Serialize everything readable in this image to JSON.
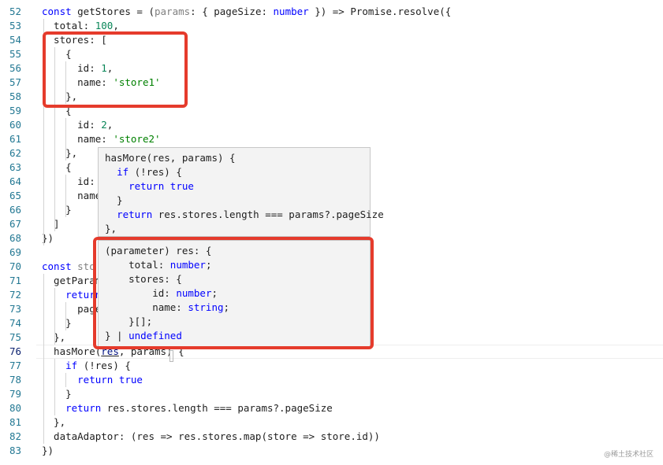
{
  "lines": [
    {
      "n": "52",
      "parts": [
        {
          "t": "const ",
          "c": "kw"
        },
        {
          "t": "getStores = (",
          "c": "plain"
        },
        {
          "t": "params",
          "c": "param"
        },
        {
          "t": ": { pageSize: ",
          "c": "plain"
        },
        {
          "t": "number",
          "c": "kw"
        },
        {
          "t": " }) => Promise.resolve({",
          "c": "plain"
        }
      ]
    },
    {
      "n": "53",
      "parts": [
        {
          "t": "  total: ",
          "c": "plain"
        },
        {
          "t": "100",
          "c": "num"
        },
        {
          "t": ",",
          "c": "plain"
        }
      ]
    },
    {
      "n": "54",
      "parts": [
        {
          "t": "  stores: [",
          "c": "plain"
        }
      ]
    },
    {
      "n": "55",
      "parts": [
        {
          "t": "    {",
          "c": "plain"
        }
      ]
    },
    {
      "n": "56",
      "parts": [
        {
          "t": "      id: ",
          "c": "plain"
        },
        {
          "t": "1",
          "c": "num"
        },
        {
          "t": ",",
          "c": "plain"
        }
      ]
    },
    {
      "n": "57",
      "parts": [
        {
          "t": "      name: ",
          "c": "plain"
        },
        {
          "t": "'store1'",
          "c": "str2"
        }
      ]
    },
    {
      "n": "58",
      "parts": [
        {
          "t": "    },",
          "c": "plain"
        }
      ]
    },
    {
      "n": "59",
      "parts": [
        {
          "t": "    {",
          "c": "plain"
        }
      ]
    },
    {
      "n": "60",
      "parts": [
        {
          "t": "      id: ",
          "c": "plain"
        },
        {
          "t": "2",
          "c": "num"
        },
        {
          "t": ",",
          "c": "plain"
        }
      ]
    },
    {
      "n": "61",
      "parts": [
        {
          "t": "      name: ",
          "c": "plain"
        },
        {
          "t": "'store2'",
          "c": "str2"
        }
      ]
    },
    {
      "n": "62",
      "parts": [
        {
          "t": "    },",
          "c": "plain"
        }
      ]
    },
    {
      "n": "63",
      "parts": [
        {
          "t": "    {",
          "c": "plain"
        }
      ]
    },
    {
      "n": "64",
      "parts": [
        {
          "t": "      id:",
          "c": "plain"
        }
      ]
    },
    {
      "n": "65",
      "parts": [
        {
          "t": "      name",
          "c": "plain"
        }
      ]
    },
    {
      "n": "66",
      "parts": [
        {
          "t": "    }",
          "c": "plain"
        }
      ]
    },
    {
      "n": "67",
      "parts": [
        {
          "t": "  ]",
          "c": "plain"
        }
      ]
    },
    {
      "n": "68",
      "parts": [
        {
          "t": "})",
          "c": "plain"
        }
      ]
    },
    {
      "n": "69",
      "parts": []
    },
    {
      "n": "70",
      "parts": [
        {
          "t": "const ",
          "c": "kw"
        },
        {
          "t": "sto",
          "c": "param"
        }
      ]
    },
    {
      "n": "71",
      "parts": [
        {
          "t": "  getParam",
          "c": "plain"
        }
      ]
    },
    {
      "n": "72",
      "parts": [
        {
          "t": "    ",
          "c": "plain"
        },
        {
          "t": "return",
          "c": "kw"
        }
      ]
    },
    {
      "n": "73",
      "parts": [
        {
          "t": "      page",
          "c": "plain"
        }
      ]
    },
    {
      "n": "74",
      "parts": [
        {
          "t": "    }",
          "c": "plain"
        }
      ]
    },
    {
      "n": "75",
      "parts": [
        {
          "t": "  },",
          "c": "plain"
        }
      ]
    },
    {
      "n": "76",
      "parts": [
        {
          "t": "  hasMore(",
          "c": "plain"
        },
        {
          "t": "res",
          "c": "prop"
        },
        {
          "t": ", params) {",
          "c": "plain"
        }
      ]
    },
    {
      "n": "77",
      "parts": [
        {
          "t": "    ",
          "c": "plain"
        },
        {
          "t": "if",
          "c": "kw"
        },
        {
          "t": " (!res) {",
          "c": "plain"
        }
      ]
    },
    {
      "n": "78",
      "parts": [
        {
          "t": "      ",
          "c": "plain"
        },
        {
          "t": "return true",
          "c": "kw"
        }
      ]
    },
    {
      "n": "79",
      "parts": [
        {
          "t": "    }",
          "c": "plain"
        }
      ]
    },
    {
      "n": "80",
      "parts": [
        {
          "t": "    ",
          "c": "plain"
        },
        {
          "t": "return",
          "c": "kw"
        },
        {
          "t": " res.stores.length === params?.pageSize",
          "c": "plain"
        }
      ]
    },
    {
      "n": "81",
      "parts": [
        {
          "t": "  },",
          "c": "plain"
        }
      ]
    },
    {
      "n": "82",
      "parts": [
        {
          "t": "  dataAdaptor: (res => res.stores.map(store => store.id))",
          "c": "plain"
        }
      ]
    },
    {
      "n": "83",
      "parts": [
        {
          "t": "})",
          "c": "plain"
        }
      ]
    }
  ],
  "active_line": "76",
  "hover_preview": [
    [
      {
        "t": "hasMore(res, params) {",
        "c": "plain"
      }
    ],
    [
      {
        "t": "  ",
        "c": "plain"
      },
      {
        "t": "if",
        "c": "kw"
      },
      {
        "t": " (!res) {",
        "c": "plain"
      }
    ],
    [
      {
        "t": "    ",
        "c": "plain"
      },
      {
        "t": "return true",
        "c": "kw"
      }
    ],
    [
      {
        "t": "  }",
        "c": "plain"
      }
    ],
    [
      {
        "t": "  ",
        "c": "plain"
      },
      {
        "t": "return",
        "c": "kw"
      },
      {
        "t": " res.stores.length === params?.pageSize",
        "c": "plain"
      }
    ],
    [
      {
        "t": "},",
        "c": "plain"
      }
    ]
  ],
  "hover_type": [
    [
      {
        "t": "(parameter) res: {",
        "c": "plain"
      }
    ],
    [
      {
        "t": "    total: ",
        "c": "plain"
      },
      {
        "t": "number",
        "c": "kw"
      },
      {
        "t": ";",
        "c": "plain"
      }
    ],
    [
      {
        "t": "    stores: {",
        "c": "plain"
      }
    ],
    [
      {
        "t": "        id: ",
        "c": "plain"
      },
      {
        "t": "number",
        "c": "kw"
      },
      {
        "t": ";",
        "c": "plain"
      }
    ],
    [
      {
        "t": "        name: ",
        "c": "plain"
      },
      {
        "t": "string",
        "c": "kw"
      },
      {
        "t": ";",
        "c": "plain"
      }
    ],
    [
      {
        "t": "    }[];",
        "c": "plain"
      }
    ],
    [
      {
        "t": "} | ",
        "c": "plain"
      },
      {
        "t": "undefined",
        "c": "kw"
      }
    ]
  ],
  "watermark": "@稀土技术社区",
  "colors": {
    "highlight_box": "#e53b2c",
    "line_number": "#237893",
    "keyword": "#0000ff",
    "string": "#008000",
    "number": "#098658"
  }
}
